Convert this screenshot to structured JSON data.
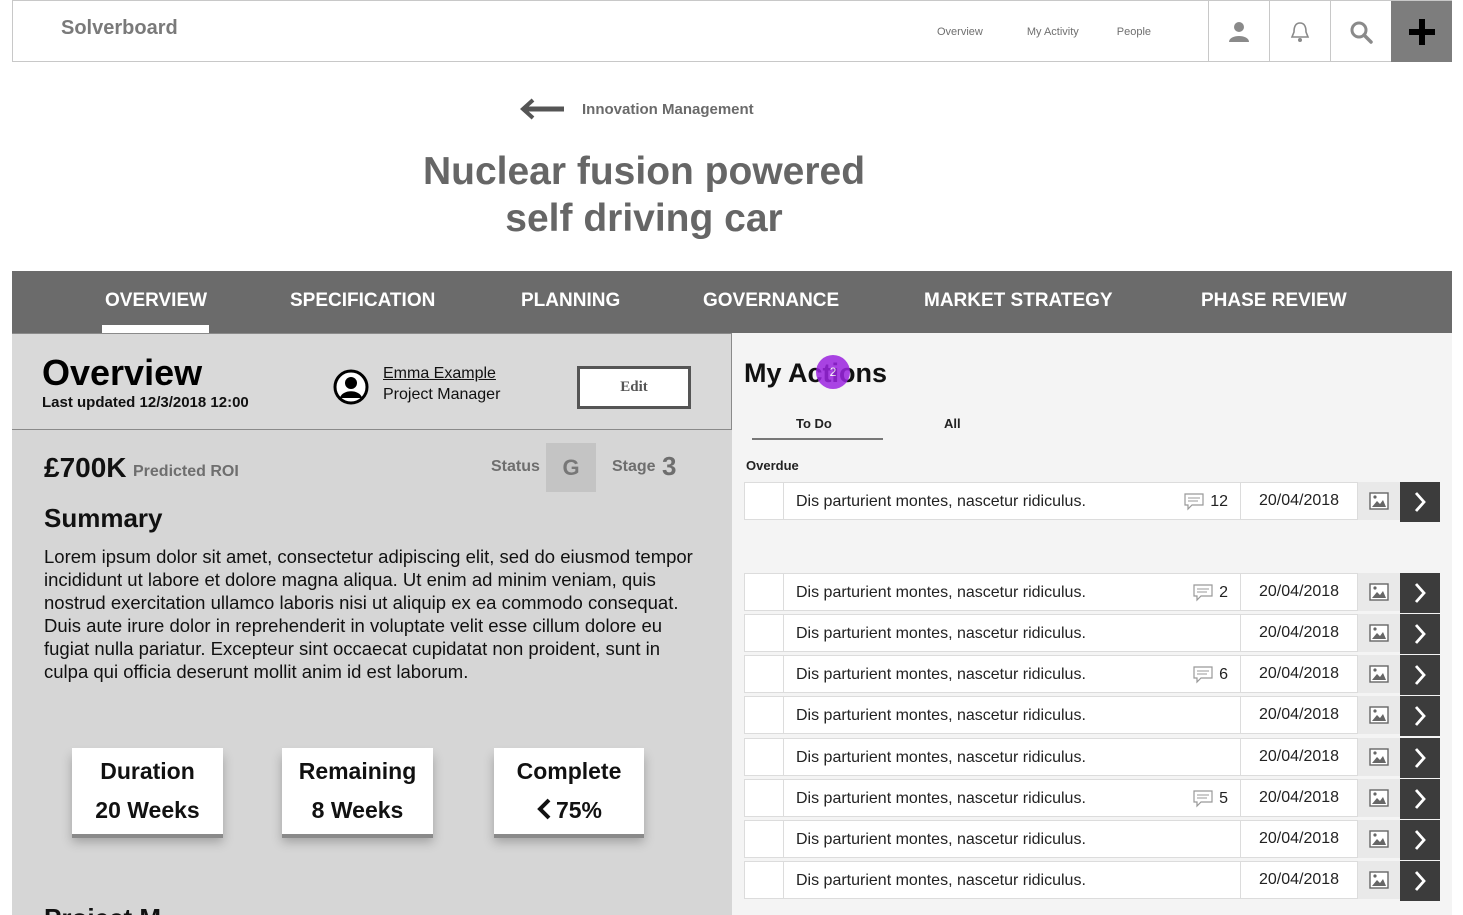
{
  "header": {
    "brand": "Solverboard",
    "links": [
      "Overview",
      "My Activity",
      "People"
    ],
    "icons": [
      "user-icon",
      "bell-icon",
      "search-icon",
      "plus-icon"
    ]
  },
  "breadcrumb": {
    "back_label": "Innovation Management"
  },
  "page": {
    "title_line1": "Nuclear fusion powered",
    "title_line2": "self driving car"
  },
  "tabs": [
    "OVERVIEW",
    "SPECIFICATION",
    "PLANNING",
    "GOVERNANCE",
    "MARKET STRATEGY",
    "PHASE REVIEW"
  ],
  "active_tab": "OVERVIEW",
  "overview": {
    "title": "Overview",
    "last_updated": "Last updated 12/3/2018 12:00",
    "manager_name": "Emma Example",
    "manager_role": "Project Manager",
    "edit_label": "Edit",
    "roi_value": "£700K",
    "roi_label": "Predicted ROI",
    "status_label": "Status",
    "status_value": "G",
    "stage_label": "Stage",
    "stage_value": "3",
    "summary_heading": "Summary",
    "summary_text": "Lorem ipsum dolor sit amet, consectetur adipiscing elit, sed do eiusmod tempor incididunt ut labore et dolore magna aliqua. Ut enim ad minim veniam, quis nostrud exercitation ullamco laboris nisi ut aliquip ex ea commodo consequat. Duis aute irure dolor in reprehenderit in voluptate velit esse cillum dolore eu fugiat nulla pariatur. Excepteur sint occaecat cupidatat non proident, sunt in culpa qui officia deserunt mollit anim id est laborum.",
    "cards": [
      {
        "label": "Duration",
        "value": "20 Weeks"
      },
      {
        "label": "Remaining",
        "value": "8 Weeks"
      },
      {
        "label": "Complete",
        "value": "75%"
      }
    ],
    "next_heading": "Project M"
  },
  "actions": {
    "title": "My Actions",
    "badge": "2",
    "subtabs": [
      "To Do",
      "All"
    ],
    "overdue_label": "Overdue",
    "overdue": [
      {
        "text": "Dis parturient montes, nascetur ridiculus.",
        "comments": "12",
        "date": "20/04/2018"
      }
    ],
    "items": [
      {
        "text": "Dis parturient montes, nascetur ridiculus.",
        "comments": "2",
        "date": "20/04/2018"
      },
      {
        "text": "Dis parturient montes, nascetur ridiculus.",
        "comments": "",
        "date": "20/04/2018"
      },
      {
        "text": "Dis parturient montes, nascetur ridiculus.",
        "comments": "6",
        "date": "20/04/2018"
      },
      {
        "text": "Dis parturient montes, nascetur ridiculus.",
        "comments": "",
        "date": "20/04/2018"
      },
      {
        "text": "Dis parturient montes, nascetur ridiculus.",
        "comments": "",
        "date": "20/04/2018"
      },
      {
        "text": "Dis parturient montes, nascetur ridiculus.",
        "comments": "5",
        "date": "20/04/2018"
      },
      {
        "text": "Dis parturient montes, nascetur ridiculus.",
        "comments": "",
        "date": "20/04/2018"
      },
      {
        "text": "Dis parturient montes, nascetur ridiculus.",
        "comments": "",
        "date": "20/04/2018"
      }
    ]
  }
}
